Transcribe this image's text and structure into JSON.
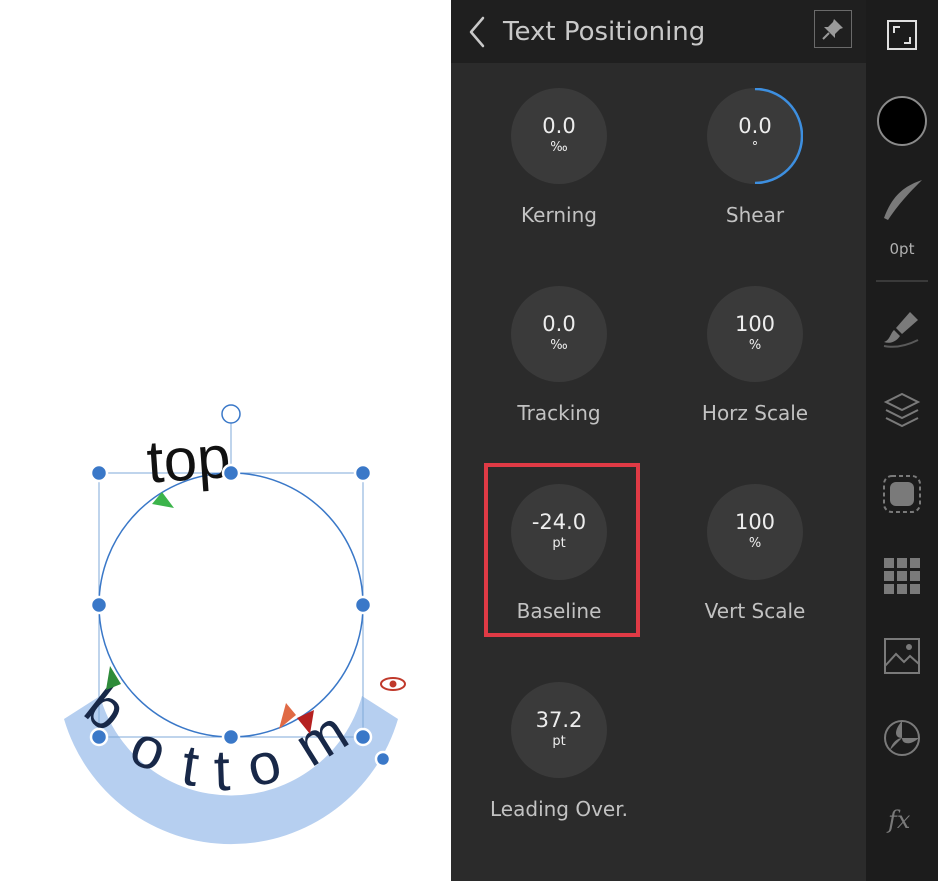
{
  "canvas": {
    "top_text": "top",
    "bottom_text": "bottom",
    "colors": {
      "selection": "#3a78c8",
      "text_band": "#b6cff0",
      "start_marker": "#3cb44b",
      "end_marker": "#c0392b"
    }
  },
  "panel": {
    "title": "Text Positioning",
    "back_icon": "chevron-left-icon",
    "pin_icon": "pin-icon",
    "controls": [
      {
        "id": "kerning",
        "value": "0.0",
        "unit": "‰",
        "label": "Kerning"
      },
      {
        "id": "shear",
        "value": "0.0",
        "unit": "°",
        "label": "Shear"
      },
      {
        "id": "tracking",
        "value": "0.0",
        "unit": "‰",
        "label": "Tracking"
      },
      {
        "id": "horz_scale",
        "value": "100",
        "unit": "%",
        "label": "Horz Scale"
      },
      {
        "id": "baseline",
        "value": "-24.0",
        "unit": "pt",
        "label": "Baseline"
      },
      {
        "id": "vert_scale",
        "value": "100",
        "unit": "%",
        "label": "Vert Scale"
      },
      {
        "id": "leading_override",
        "value": "37.2",
        "unit": "pt",
        "label": "Leading Over."
      }
    ],
    "highlight_color": "#e03a45"
  },
  "toolbar": {
    "stroke_width": "0pt",
    "fill_color": "#000000",
    "tools": [
      "fullscreen-icon",
      "fill-color-swatch",
      "stroke-brush-icon",
      "brush-icon",
      "layers-icon",
      "selection-icon",
      "grid-icon",
      "image-icon",
      "color-wheel-icon",
      "fx-icon"
    ]
  }
}
